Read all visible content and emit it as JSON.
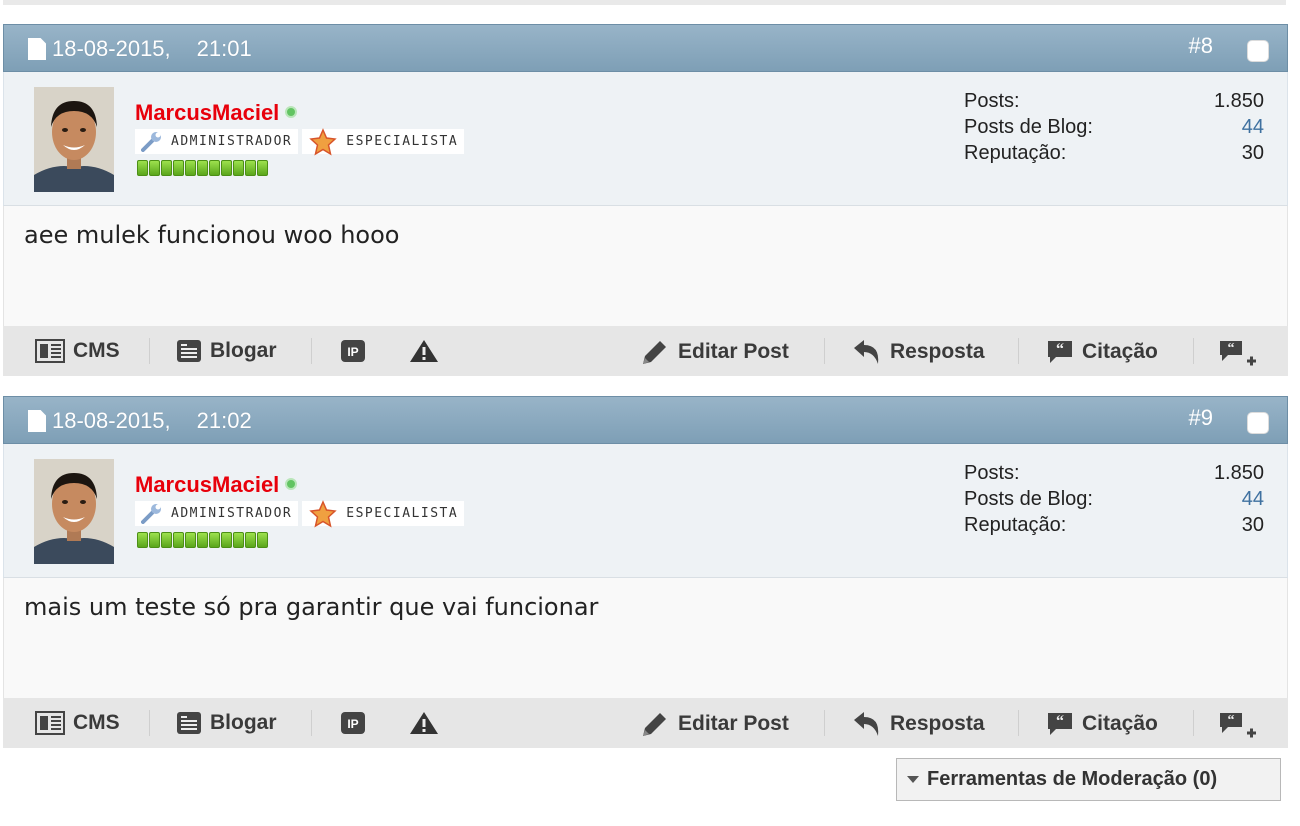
{
  "posts": [
    {
      "date": "18-08-2015,",
      "time": "21:01",
      "number": "#8",
      "username": "MarcusMaciel",
      "rank1": "ADMINISTRADOR",
      "rank2": "ESPECIALISTA",
      "stats": [
        {
          "label": "Posts:",
          "value": "1.850"
        },
        {
          "label": "Posts de Blog:",
          "value": "44"
        },
        {
          "label": "Reputação:",
          "value": "30"
        }
      ],
      "content": "aee mulek funcionou woo hooo"
    },
    {
      "date": "18-08-2015,",
      "time": "21:02",
      "number": "#9",
      "username": "MarcusMaciel",
      "rank1": "ADMINISTRADOR",
      "rank2": "ESPECIALISTA",
      "stats": [
        {
          "label": "Posts:",
          "value": "1.850"
        },
        {
          "label": "Posts de Blog:",
          "value": "44"
        },
        {
          "label": "Reputação:",
          "value": "30"
        }
      ],
      "content": "mais um teste só pra garantir que vai funcionar"
    }
  ],
  "controls": {
    "cms": "CMS",
    "blogar": "Blogar",
    "editar": "Editar Post",
    "resposta": "Resposta",
    "citacao": "Citação"
  },
  "icons": {
    "cms": "newspaper-icon",
    "blogar": "blog-icon",
    "ip": "ip-icon",
    "report": "warning-icon",
    "edit": "pencil-icon",
    "reply": "reply-arrow-icon",
    "quote": "quote-icon",
    "multiquote": "multiquote-icon"
  },
  "colors": {
    "username": "#e8000b",
    "header": "#8aa8bd",
    "link_blue": "#3f71a0"
  },
  "moderation": {
    "label": "Ferramentas de Moderação (0)"
  }
}
